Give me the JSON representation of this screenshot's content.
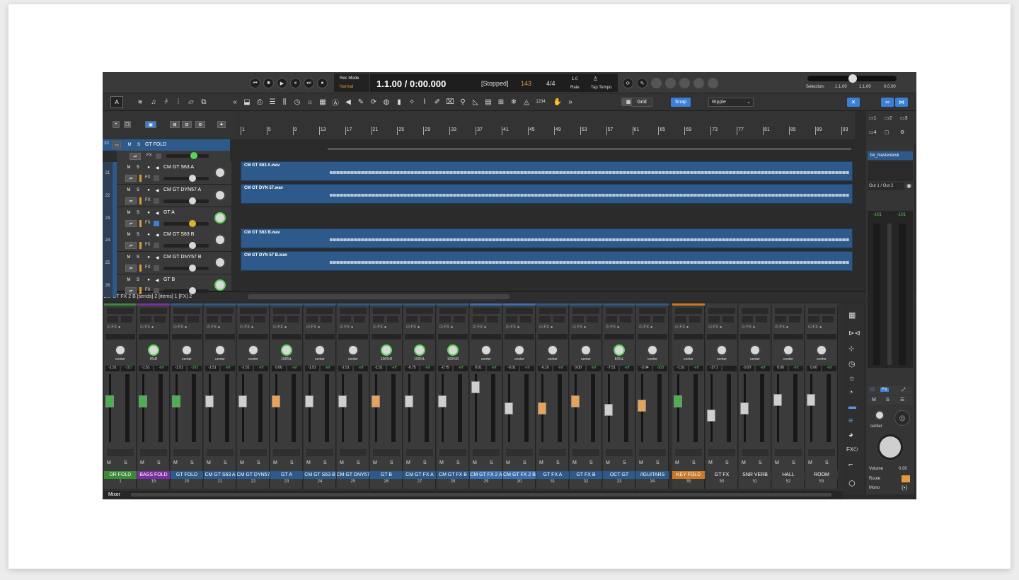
{
  "transport": {
    "rec_mode_label": "Rec Mode",
    "rec_mode_value": "Normal",
    "time": "1.1.00 / 0:00.000",
    "state": "[Stopped]",
    "tempo": "143",
    "signature": "4/4",
    "rate_value": "1.0",
    "rate_label": "Rate",
    "tap_label": "Tap Tempo"
  },
  "selection": {
    "label": "Selection:",
    "start": "1.1.00",
    "end": "1.1.00",
    "length": "0.0.00"
  },
  "toolbar2": {
    "grid": "Grid",
    "snap": "Snap",
    "ripple": "Ripple",
    "count": "1234"
  },
  "ruler": [
    "1",
    "5",
    "9",
    "13",
    "17",
    "21",
    "25",
    "29",
    "33",
    "37",
    "41",
    "45",
    "49",
    "53",
    "57",
    "61",
    "65",
    "69",
    "73",
    "77",
    "81",
    "85",
    "89",
    "93"
  ],
  "tracks": [
    {
      "num": "20",
      "name": "GT FOLD"
    },
    {
      "num": "21",
      "name": "CM GT S63 A"
    },
    {
      "num": "22",
      "name": "CM GT DYN57 A"
    },
    {
      "num": "23",
      "name": "GT A"
    },
    {
      "num": "24",
      "name": "CM GT S63 B"
    },
    {
      "num": "25",
      "name": "CM GT DNY57 B"
    },
    {
      "num": "26",
      "name": "GT B"
    }
  ],
  "clips": [
    "CM GT S63 A.wav",
    "CM GT DYN 57.wav",
    "CM GT S63 B.wav",
    "CM GT DYN 57 B.wav"
  ],
  "status": "CM GT FX 2 B [sends] 2 [items] 1 [FX] 2",
  "mixer": [
    {
      "name": "DR FOLD",
      "num": "1",
      "pan": "center",
      "vol": "-1.51",
      "peak": "-110",
      "color": "#3a8a3a"
    },
    {
      "name": "BASS FOLD",
      "num": "15",
      "pan": "6%R",
      "vol": "-1.51",
      "peak": "-inf",
      "color": "#7a2fa0"
    },
    {
      "name": "GT FOLD",
      "num": "20",
      "pan": "center",
      "vol": "-1.51",
      "peak": "-103",
      "color": "#2d5a8b"
    },
    {
      "name": "CM GT S63 A",
      "num": "21",
      "pan": "center",
      "vol": "-1.51",
      "peak": "-inf",
      "color": "#2d5a8b"
    },
    {
      "name": "CM GT DYN57",
      "num": "22",
      "pan": "center",
      "vol": "-1.51",
      "peak": "-inf",
      "color": "#2d5a8b"
    },
    {
      "name": "GT A",
      "num": "23",
      "pan": "100%L",
      "vol": "0.00",
      "peak": "-inf",
      "color": "#2d5a8b"
    },
    {
      "name": "CM GT S63 B",
      "num": "24",
      "pan": "center",
      "vol": "-1.51",
      "peak": "-inf",
      "color": "#2d5a8b"
    },
    {
      "name": "CM GT DNY57",
      "num": "25",
      "pan": "center",
      "vol": "-1.51",
      "peak": "-inf",
      "color": "#2d5a8b"
    },
    {
      "name": "GT B",
      "num": "26",
      "pan": "100%R",
      "vol": "-1.51",
      "peak": "-inf",
      "color": "#2d5a8b"
    },
    {
      "name": "CM GT FX A",
      "num": "27",
      "pan": "100%L",
      "vol": "-0.75",
      "peak": "-inf",
      "color": "#2d5a8b"
    },
    {
      "name": "CM GT FX B",
      "num": "28",
      "pan": "100%R",
      "vol": "-0.75",
      "peak": "-inf",
      "color": "#2d5a8b"
    },
    {
      "name": "CM GT FX 2 A",
      "num": "29",
      "pan": "center",
      "vol": "0.01",
      "peak": "-inf",
      "color": "#3a6fb0"
    },
    {
      "name": "CM GT FX 2 B",
      "num": "30",
      "pan": "center",
      "vol": "-0.01",
      "peak": "-inf",
      "color": "#3a6fb0"
    },
    {
      "name": "GT FX A",
      "num": "31",
      "pan": "center",
      "vol": "-6.10",
      "peak": "-inf",
      "color": "#2d5a8b"
    },
    {
      "name": "GT FX B",
      "num": "32",
      "pan": "center",
      "vol": "0.00",
      "peak": "-inf",
      "color": "#2d5a8b"
    },
    {
      "name": "OCT GT",
      "num": "33",
      "pan": "83%L",
      "vol": "-7.51",
      "peak": "-inf",
      "color": "#2d5a8b"
    },
    {
      "name": "//GUITARS",
      "num": "34",
      "pan": "center",
      "vol": "-3.04",
      "peak": "-103",
      "color": "#2d5a8b"
    },
    {
      "name": "KEY FOLD",
      "num": "35",
      "pan": "center",
      "vol": "-1.51",
      "peak": "-inf",
      "color": "#c87a2a"
    },
    {
      "name": "GT FX",
      "num": "50",
      "pan": "center",
      "vol": "-17.1",
      "peak": "",
      "color": "#3a3a3a"
    },
    {
      "name": "SNR VERB",
      "num": "51",
      "pan": "center",
      "vol": "-9.97",
      "peak": "-inf",
      "color": "#3a3a3a"
    },
    {
      "name": "HALL",
      "num": "52",
      "pan": "center",
      "vol": "0.00",
      "peak": "-inf",
      "color": "#3a3a3a"
    },
    {
      "name": "ROOM",
      "num": "53",
      "pan": "center",
      "vol": "0.00",
      "peak": "-inf",
      "color": "#3a3a3a"
    }
  ],
  "master": {
    "title": "bx_masterdesk",
    "out": "Out 1 / Out 2",
    "peakL": "-101",
    "peakR": "-101",
    "pan": "center",
    "volume_label": "Volume",
    "volume_value": "0.00",
    "route": "Route",
    "mono": "Mono"
  },
  "mixer_tab": "Mixer"
}
